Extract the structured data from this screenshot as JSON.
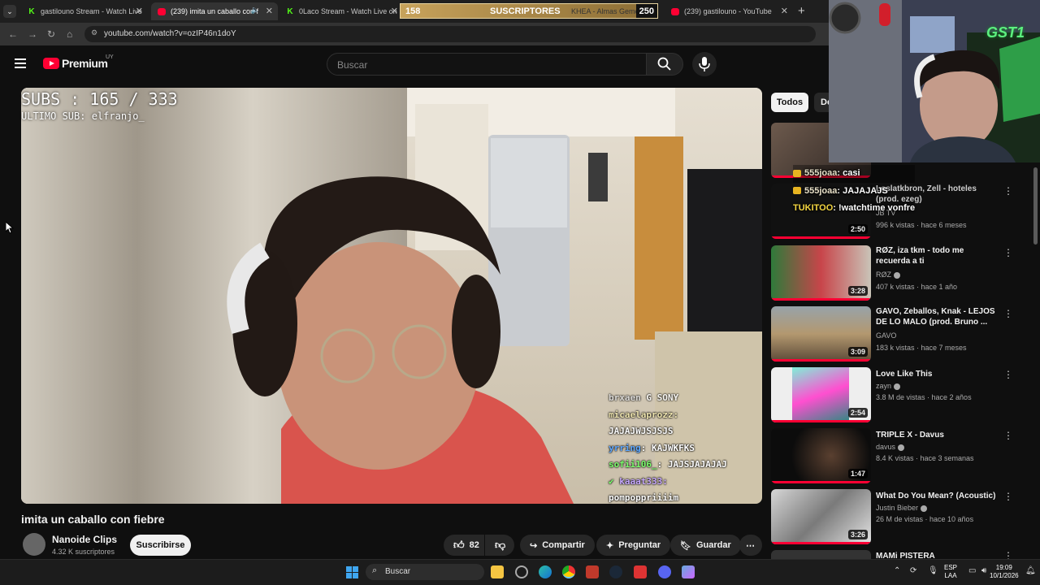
{
  "browser": {
    "tabs": [
      {
        "title": "gastilouno Stream - Watch Live",
        "icon": "kick-icon"
      },
      {
        "title": "(239) imita un caballo con f",
        "icon": "youtube-icon"
      },
      {
        "title": "0Laco Stream - Watch Live on K",
        "icon": "kick-icon"
      },
      {
        "title": "KHEA - Almas Gemel",
        "icon": "youtube-icon"
      },
      {
        "title": "(239) gastilouno - YouTube",
        "icon": "youtube-icon"
      }
    ],
    "new_tab": "+",
    "url": "youtube.com/watch?v=ozIP46n1doY"
  },
  "sub_goal": {
    "current": "158",
    "label": "SUSCRIPTORES",
    "target": "250"
  },
  "youtube": {
    "brand": "Premium",
    "country": "UY",
    "search_placeholder": "Buscar"
  },
  "video": {
    "subs_overlay": "SUBS : 165 / 333",
    "last_sub": "ULTIMO SUB:  elfranjo_",
    "chat": [
      {
        "user": "brxaen",
        "msg": "G SONY"
      },
      {
        "user": "micaelaprozz:",
        "msg": ""
      },
      {
        "user": "",
        "msg": "JAJAJWJSJSJS"
      },
      {
        "user": "yrring",
        "msg": ": KAJWKFKS"
      },
      {
        "user": "sofii106_",
        "msg": ": JAJSJAJAJAJ"
      },
      {
        "user": "kaaat333:",
        "msg": ""
      },
      {
        "user": "",
        "msg": "pompoppriiiim"
      }
    ],
    "title": "imita un caballo con fiebre",
    "channel": "Nanoide Clips",
    "channel_subs": "4.32 K suscriptores",
    "subscribe": "Suscribirse",
    "likes": "82",
    "share": "Compartir",
    "ask": "Preguntar",
    "save": "Guardar"
  },
  "chips": [
    "Todos",
    "De"
  ],
  "recommendations": [
    {
      "title": "Loslatkbron, Zell - hoteles (prod. ezeg)",
      "channel": "JB TV",
      "meta": "996 k vistas · hace 6 meses",
      "duration": "2:50"
    },
    {
      "title": "RØZ, iza tkm - todo me recuerda a ti",
      "channel": "RØZ",
      "meta": "407 k vistas · hace 1 año",
      "duration": "3:28"
    },
    {
      "title": "GAVO, Zeballos, Knak - LEJOS DE LO MALO (prod. Bruno ...",
      "channel": "GAVO",
      "meta": "183 k vistas · hace 7 meses",
      "duration": "3:09"
    },
    {
      "title": "Love Like This",
      "channel": "zayn",
      "meta": "3.8 M de vistas · hace 2 años",
      "duration": "2:54"
    },
    {
      "title": "TRIPLE X - Davus",
      "channel": "davus",
      "meta": "8.4 K vistas · hace 3 semanas",
      "duration": "1:47"
    },
    {
      "title": "What Do You Mean? (Acoustic)",
      "channel": "Justin Bieber",
      "meta": "26 M de vistas · hace 10 años",
      "duration": "3:26"
    },
    {
      "title": "MAMi PISTERA",
      "channel": "",
      "meta": "",
      "duration": ""
    }
  ],
  "stream_chat": [
    {
      "user": "555joaa",
      "msg": ": casi"
    },
    {
      "user": "555joaa",
      "msg": ": JAJAJAJS"
    },
    {
      "user": "TUKITOO",
      "msg": ": !watchtime vonfre"
    }
  ],
  "webcam_logo": "GST1",
  "taskbar": {
    "search": "Buscar",
    "lang": "ESP",
    "lang2": "LAA",
    "time": "19:09",
    "date": "10/1/2026"
  }
}
